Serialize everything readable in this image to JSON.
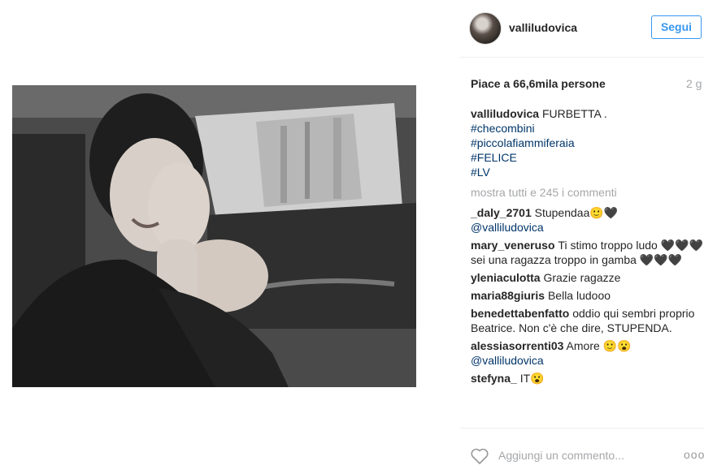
{
  "post": {
    "username": "valliludovica",
    "follow_label": "Segui",
    "likes": "Piace a 66,6mila persone",
    "time": "2 g"
  },
  "caption": {
    "username": "valliludovica",
    "text": "FURBETTA .",
    "hashtags": [
      "#checombini",
      "#piccolafiammiferaia",
      "#FELICE",
      "#LV"
    ]
  },
  "view_all_comments": "mostra tutti e 245 i commenti",
  "comments": [
    {
      "username": "_daly_2701",
      "text": "Stupendaa🙂🖤",
      "mention": "@valliludovica"
    },
    {
      "username": "mary_venerusο",
      "text": "Ti stimo troppo ludo 🖤🖤🖤 sei una ragazza troppo in gamba 🖤🖤🖤",
      "mention": ""
    },
    {
      "username": "yleniaculotta",
      "text": "Grazie ragazze",
      "mention": ""
    },
    {
      "username": "maria88giuris",
      "text": "Bella ludooo",
      "mention": ""
    },
    {
      "username": "benedettabenfatto",
      "text": "oddio qui sembri proprio Beatrice. Non c'è che dire, STUPENDA.",
      "mention": ""
    },
    {
      "username": "alessiasorrenti03",
      "text": "Amore 🙂😮",
      "mention": "@valliludovica"
    },
    {
      "username": "stefyna_",
      "text": "IT😮",
      "mention": ""
    }
  ],
  "footer": {
    "add_comment_placeholder": "Aggiungi un commento...",
    "options_label": "ooo",
    "like_icon": "heart-outline-icon"
  },
  "colors": {
    "accent": "#3897f0",
    "link": "#003569",
    "muted": "#a5a7aa"
  }
}
